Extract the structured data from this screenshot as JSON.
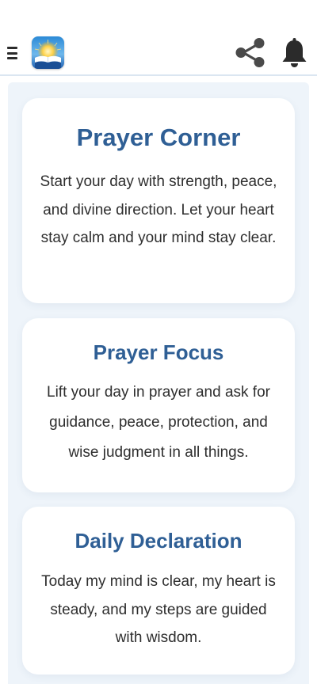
{
  "header": {
    "menu_icon": "hamburger-menu-icon",
    "logo_icon": "open-bible-sunrise-logo",
    "share_icon": "share-icon",
    "notifications_icon": "bell-icon"
  },
  "cards": [
    {
      "title": "Prayer Corner",
      "body": "Start your day with strength, peace, and divine direction. Let your heart stay calm and your mind stay clear."
    },
    {
      "title": "Prayer Focus",
      "body": "Lift your day in prayer and ask for guidance, peace, protection, and wise judgment in all things."
    },
    {
      "title": "Daily Declaration",
      "body": "Today my mind is clear, my heart is steady, and my steps are guided with wisdom."
    }
  ],
  "colors": {
    "title_blue": "#2f5f95",
    "body_text": "#2e2e2e",
    "content_background": "#eef4fa",
    "card_background": "#ffffff",
    "icon_gray": "#4a4a4a"
  }
}
